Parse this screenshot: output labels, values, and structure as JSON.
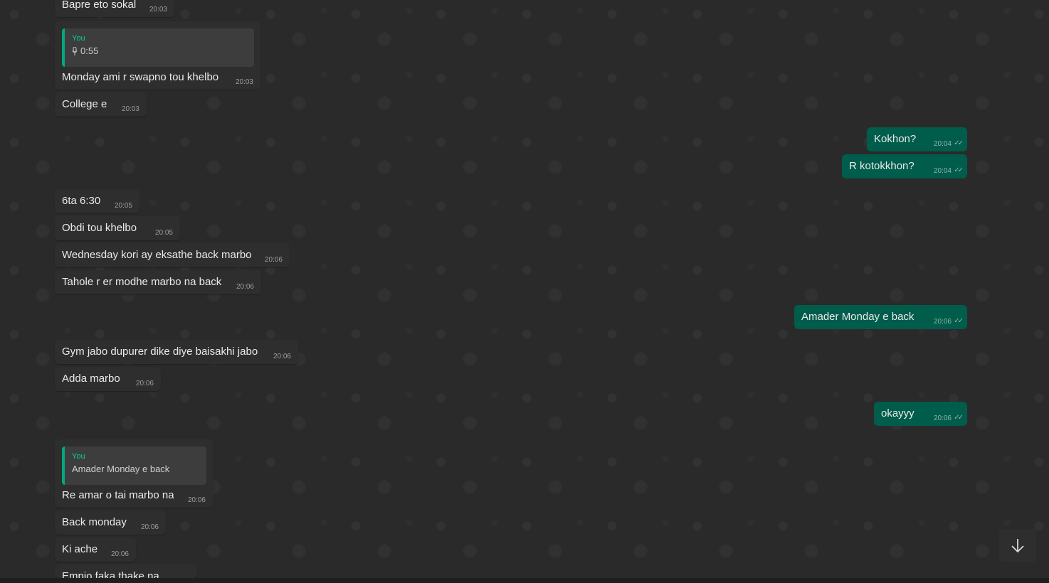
{
  "messages": [
    {
      "text": "Bapre eto sokal",
      "time": "20:03"
    },
    {
      "reply_author": "You",
      "reply_text": "0:55",
      "text": "Monday ami r swapno tou khelbo",
      "time": "20:03"
    },
    {
      "text": "College e",
      "time": "20:03"
    },
    {
      "text": "Kokhon?",
      "time": "20:04"
    },
    {
      "text": "R kotokkhon?",
      "time": "20:04"
    },
    {
      "text": "6ta 6:30",
      "time": "20:05"
    },
    {
      "text": "Obdi tou khelbo",
      "time": "20:05"
    },
    {
      "text": "Wednesday kori ay eksathe back marbo",
      "time": "20:06"
    },
    {
      "text": "Tahole r er modhe marbo na back",
      "time": "20:06"
    },
    {
      "text": "Amader Monday e back",
      "time": "20:06"
    },
    {
      "text": "Gym jabo dupurer dike diye baisakhi jabo",
      "time": "20:06"
    },
    {
      "text": "Adda marbo",
      "time": "20:06"
    },
    {
      "text": "okayyy",
      "time": "20:06"
    },
    {
      "reply_author": "You",
      "reply_text": "Amader Monday e back",
      "text": "Re amar o tai marbo na",
      "time": "20:06"
    },
    {
      "text": "Back monday",
      "time": "20:06"
    },
    {
      "text": "Ki ache",
      "time": "20:06"
    },
    {
      "text": "Empio faka thake na",
      "time": ""
    }
  ],
  "icons": {
    "read_receipt": "double-check-icon",
    "voice_note": "mic-icon",
    "scroll_down": "arrow-down-icon"
  },
  "colors": {
    "background": "#2a2a2a",
    "incoming_bubble": "#2e2e2e",
    "outgoing_bubble": "#005c4b",
    "quote_accent": "#00a884",
    "author_green": "#06cf9c"
  }
}
